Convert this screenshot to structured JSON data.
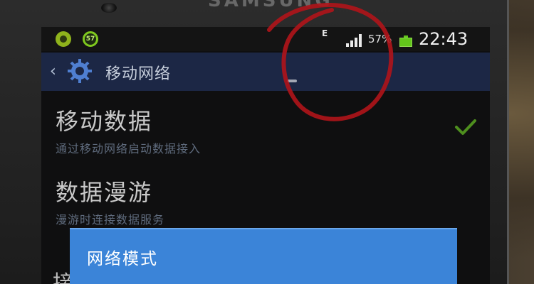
{
  "device": {
    "brand": "SAMSUNG"
  },
  "statusbar": {
    "left_icons": [
      "app-notification-icon",
      "timer-notification-icon"
    ],
    "timer_badge": "57",
    "network_type": "E",
    "signal_icon": "signal-strength-icon",
    "battery_percent": "57%",
    "battery_icon": "battery-icon",
    "battery_color": "#63c61b",
    "time": "22:43"
  },
  "actionbar": {
    "back_icon": "chevron-left-icon",
    "settings_icon": "gear-icon",
    "title": "移动网络",
    "background": "#1c2745"
  },
  "settings": [
    {
      "title": "移动数据",
      "subtitle": "通过移动网络启动数据接入",
      "checked": true
    },
    {
      "title": "数据漫游",
      "subtitle": "漫游时连接数据服务"
    }
  ],
  "partial_item_first_char": "接",
  "dialog": {
    "title": "网络模式",
    "background": "#3b84d8"
  },
  "annotation": {
    "type": "hand-drawn-circle",
    "color": "#b0141a"
  }
}
